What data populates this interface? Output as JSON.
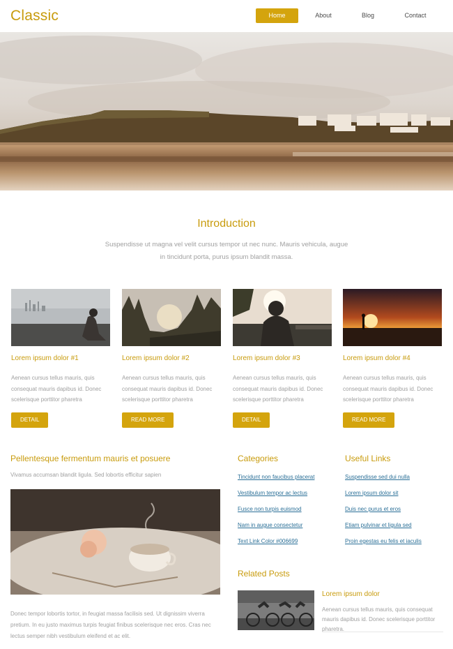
{
  "site": {
    "logo": "Classic"
  },
  "nav": [
    {
      "label": "Home",
      "active": true
    },
    {
      "label": "About",
      "active": false
    },
    {
      "label": "Blog",
      "active": false
    },
    {
      "label": "Contact",
      "active": false
    }
  ],
  "intro": {
    "title": "Introduction",
    "text": "Suspendisse ut magna vel velit cursus tempor ut nec nunc. Mauris vehicula, augue in tincidunt porta, purus ipsum blandit massa."
  },
  "cards": [
    {
      "title": "Lorem ipsum dolor #1",
      "text": "Aenean cursus tellus mauris, quis consequat mauris dapibus id. Donec scelerisque porttitor pharetra",
      "button": "DETAIL"
    },
    {
      "title": "Lorem ipsum dolor #2",
      "text": "Aenean cursus tellus mauris, quis consequat mauris dapibus id. Donec scelerisque porttitor pharetra",
      "button": "READ MORE"
    },
    {
      "title": "Lorem ipsum dolor #3",
      "text": "Aenean cursus tellus mauris, quis consequat mauris dapibus id. Donec scelerisque porttitor pharetra",
      "button": "DETAIL"
    },
    {
      "title": "Lorem ipsum dolor #4",
      "text": "Aenean cursus tellus mauris, quis consequat mauris dapibus id. Donec scelerisque porttitor pharetra",
      "button": "READ MORE"
    }
  ],
  "feature": {
    "title": "Pellentesque fermentum mauris et posuere",
    "subtitle": "Vivamus accumsan blandit ligula. Sed lobortis efficitur sapien",
    "text": "Donec tempor lobortis tortor, in feugiat massa facilisis sed. Ut dignissim viverra pretium. In eu justo maximus turpis feugiat finibus scelerisque nec eros. Cras nec lectus semper nibh vestibulum eleifend et ac elit."
  },
  "categories": {
    "title": "Categories",
    "items": [
      "Tincidunt non faucibus placerat",
      "Vestibulum tempor ac lectus",
      "Fusce non turpis euismod",
      "Nam in augue consectetur",
      "Text Link Color #006699"
    ]
  },
  "useful_links": {
    "title": "Useful Links",
    "items": [
      "Suspendisse sed dui nulla",
      "Lorem ipsum dolor sit",
      "Duis nec purus et eros",
      "Etiam pulvinar et ligula sed",
      "Proin egestas eu felis et iaculis"
    ]
  },
  "related": {
    "title": "Related Posts",
    "post_title": "Lorem ipsum dolor",
    "post_text": "Aenean cursus tellus mauris, quis consequat mauris dapibus id. Donec scelerisque porttitor pharetra."
  },
  "colors": {
    "accent": "#c89b0c",
    "button": "#d4a40d",
    "link": "#2a6f97"
  }
}
